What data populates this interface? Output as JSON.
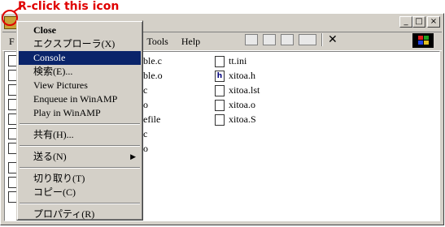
{
  "annotation": {
    "text": "R-click this icon"
  },
  "window": {
    "controls": [
      "_",
      "□",
      "×"
    ],
    "menu": [
      "F",
      "s",
      "Tools",
      "Help"
    ]
  },
  "files": {
    "col1": [
      "ble.c",
      "ble.o",
      "c",
      "o",
      "efile",
      "c",
      "o"
    ],
    "col2": [
      {
        "name": "tt.ini",
        "icon": "text-file-icon"
      },
      {
        "name": "xitoa.h",
        "icon": "header-file-icon"
      },
      {
        "name": "xitoa.lst",
        "icon": "text-file-icon"
      },
      {
        "name": "xitoa.o",
        "icon": "object-file-icon"
      },
      {
        "name": "xitoa.S",
        "icon": "text-file-icon"
      }
    ]
  },
  "context_menu": {
    "items": [
      {
        "label": "Close",
        "bold": true
      },
      {
        "label": "エクスプローラ(X)"
      },
      {
        "label": "Console",
        "highlighted": true
      },
      {
        "label": "検索(E)..."
      },
      {
        "label": "View Pictures"
      },
      {
        "label": "Enqueue in WinAMP"
      },
      {
        "label": "Play in WinAMP"
      },
      {
        "separator": true
      },
      {
        "label": "共有(H)..."
      },
      {
        "separator": true
      },
      {
        "label": "送る(N)",
        "submenu": true
      },
      {
        "separator": true
      },
      {
        "label": "切り取り(T)"
      },
      {
        "label": "コピー(C)"
      },
      {
        "separator": true
      },
      {
        "label": "プロパティ(R)"
      }
    ]
  },
  "colors": {
    "annotation": "#e00000",
    "highlight": "#0a246a"
  }
}
